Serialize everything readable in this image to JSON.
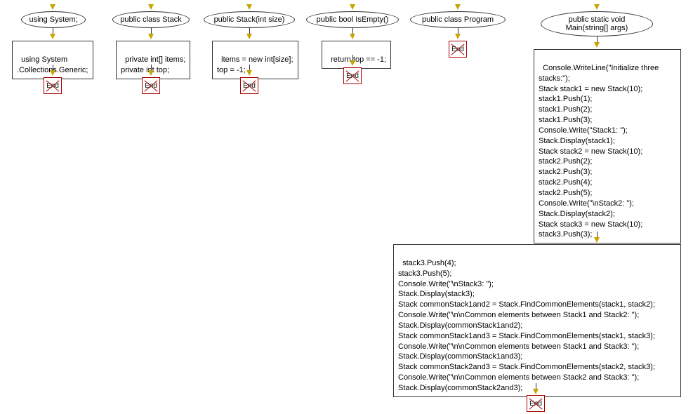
{
  "end_label": "End",
  "flows": [
    {
      "id": "f1",
      "ellipse": "using System;",
      "box": "using System\n.Collections.Generic;"
    },
    {
      "id": "f2",
      "ellipse": "public class Stack",
      "box": "private int[] items;\nprivate int top;"
    },
    {
      "id": "f3",
      "ellipse": "public Stack(int size)",
      "box": "items = new int[size];\ntop = -1;"
    },
    {
      "id": "f4",
      "ellipse": "public bool IsEmpty()",
      "box": "return top == -1;"
    },
    {
      "id": "f5",
      "ellipse": "public class Program",
      "box": null
    },
    {
      "id": "f6",
      "ellipse": "public static void\nMain(string[] args)",
      "box1": "Console.WriteLine(\"Initialize three\nstacks:\");\nStack stack1 = new Stack(10);\nstack1.Push(1);\nstack1.Push(2);\nstack1.Push(3);\nConsole.Write(\"Stack1: \");\nStack.Display(stack1);\nStack stack2 = new Stack(10);\nstack2.Push(2);\nstack2.Push(3);\nstack2.Push(4);\nstack2.Push(5);\nConsole.Write(\"\\nStack2: \");\nStack.Display(stack2);\nStack stack3 = new Stack(10);\nstack3.Push(3);",
      "box2": "stack3.Push(4);\nstack3.Push(5);\nConsole.Write(\"\\nStack3: \");\nStack.Display(stack3);\nStack commonStack1and2 = Stack.FindCommonElements(stack1, stack2);\nConsole.Write(\"\\n\\nCommon elements between Stack1 and Stack2: \");\nStack.Display(commonStack1and2);\nStack commonStack1and3 = Stack.FindCommonElements(stack1, stack3);\nConsole.Write(\"\\n\\nCommon elements between Stack1 and Stack3: \");\nStack.Display(commonStack1and3);\nStack commonStack2and3 = Stack.FindCommonElements(stack2, stack3);\nConsole.Write(\"\\n\\nCommon elements between Stack2 and Stack3: \");\nStack.Display(commonStack2and3);"
    }
  ]
}
